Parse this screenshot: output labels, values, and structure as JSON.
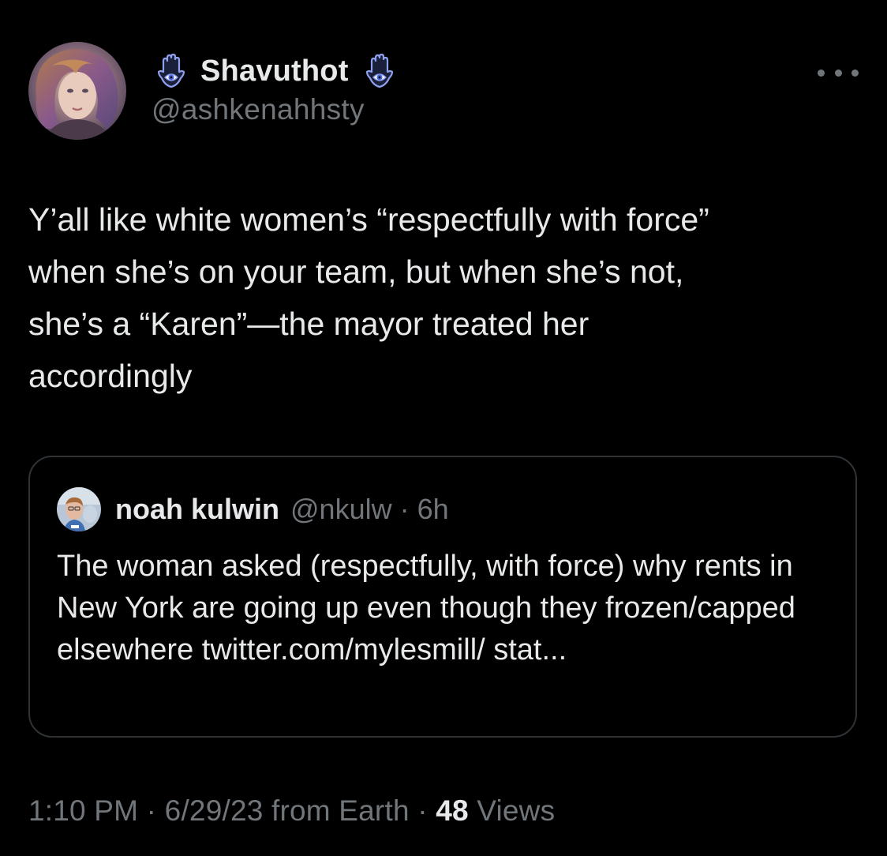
{
  "author": {
    "display_name": "Shavuthot",
    "handle": "@ashkenahhsty",
    "avatar_icon": "avatar-portrait",
    "badge_icon": "hamsa-icon",
    "badge_color": "#7b8fe0"
  },
  "tweet": {
    "text": "Y’all like white women’s “respectfully with force”\nwhen she’s on your team, but when she’s not,\nshe’s a “Karen”—the mayor treated her\naccordingly"
  },
  "quote": {
    "display_name": "noah kulwin",
    "meta": "@nkulw · 6h",
    "text": "The woman asked (respectfully, with force) why rents in New York are going up even though they frozen/capped elsewhere twitter.com/mylesmill/ stat..."
  },
  "footer": {
    "time": "1:10 PM · 6/29/23 from Earth · ",
    "views_count": "48",
    "views_label": " Views"
  },
  "colors": {
    "background": "#000000",
    "primary_text": "#e7e9ea",
    "secondary_text": "#71767b",
    "border": "#2f3336"
  }
}
